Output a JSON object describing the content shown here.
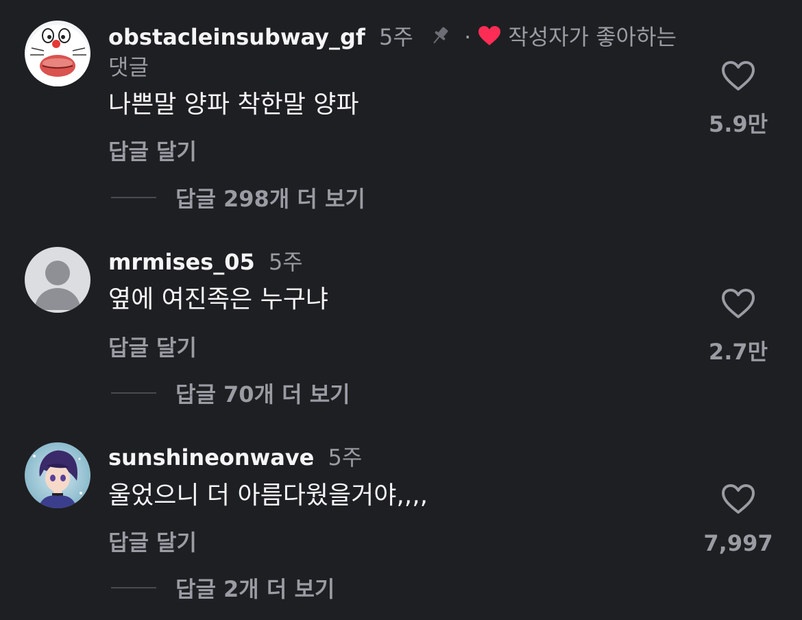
{
  "colors": {
    "background": "#1e1f22",
    "text_primary": "#f5f5f7",
    "text_secondary": "#9a9ba3",
    "heart_red": "#ff2d55",
    "divider": "#4a4b51"
  },
  "comments": [
    {
      "username": "obstacleinsubway_gf",
      "time": "5주",
      "pinned": true,
      "pin_icon": "pin-icon",
      "separator": "·",
      "liked_by_creator_icon": "heart-filled-icon",
      "liked_by_creator_text": "작성자가 좋아하는 댓글",
      "text": "나쁜말 양파 착한말 양파",
      "reply_label": "답글 달기",
      "view_replies": "답글 298개 더 보기",
      "like_count": "5.9만",
      "avatar": "doraemon-avatar"
    },
    {
      "username": "mrmises_05",
      "time": "5주",
      "text": "옆에 여진족은 누구냐",
      "reply_label": "답글 달기",
      "view_replies": "답글 70개 더 보기",
      "like_count": "2.7만",
      "avatar": "default-avatar"
    },
    {
      "username": "sunshineonwave",
      "time": "5주",
      "text": "울었으니 더 아름다웠을거야,,,,",
      "reply_label": "답글 달기",
      "view_replies": "답글 2개 더 보기",
      "like_count": "7,997",
      "avatar": "anime-avatar"
    }
  ]
}
